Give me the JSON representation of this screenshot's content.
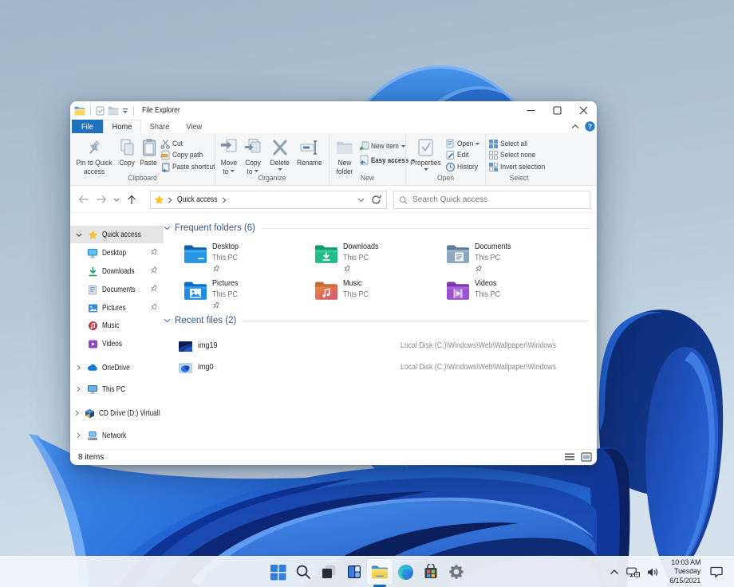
{
  "colors": {
    "accent_blue": "#2071bc",
    "heading_blue": "#33558f",
    "taskbar_bg": "#f2f6fa",
    "wallpaper_light": "#aec3d6",
    "wallpaper_bloom_dark": "#0e2f7e",
    "wallpaper_bloom_bright": "#2e6fdb"
  },
  "window": {
    "title": "File Explorer",
    "qat_icons": [
      "explorer-folder-icon",
      "properties-icon",
      "new-folder-icon",
      "customize-dropdown"
    ],
    "caption": {
      "minimize": "minimize",
      "maximize": "maximize",
      "close": "close"
    },
    "tabs": [
      {
        "label": "File"
      },
      {
        "label": "Home"
      },
      {
        "label": "Share"
      },
      {
        "label": "View"
      }
    ],
    "help_icon": "?"
  },
  "ribbon": {
    "groups": [
      {
        "label": "Clipboard",
        "big": [
          {
            "label": "Pin to Quick access",
            "icon": "pin"
          },
          {
            "label": "Copy",
            "icon": "copy"
          },
          {
            "label": "Paste",
            "icon": "paste"
          }
        ],
        "small": [
          {
            "label": "Cut",
            "icon": "cut"
          },
          {
            "label": "Copy path",
            "icon": "copy-path"
          },
          {
            "label": "Paste shortcut",
            "icon": "paste-shortcut"
          }
        ]
      },
      {
        "label": "Organize",
        "big": [
          {
            "label": "Move to",
            "icon": "move-to",
            "dropdown": true
          },
          {
            "label": "Copy to",
            "icon": "copy-to",
            "dropdown": true
          },
          {
            "label": "Delete",
            "icon": "delete",
            "dropdown": true
          },
          {
            "label": "Rename",
            "icon": "rename"
          }
        ]
      },
      {
        "label": "New",
        "big": [
          {
            "label": "New folder",
            "icon": "new-folder"
          }
        ],
        "small": [
          {
            "label": "New item",
            "icon": "new-item",
            "dropdown": true
          },
          {
            "label": "Easy access",
            "icon": "easy-access",
            "dropdown": true
          }
        ]
      },
      {
        "label": "Open",
        "big": [
          {
            "label": "Properties",
            "icon": "properties",
            "dropdown": true
          }
        ],
        "small": [
          {
            "label": "Open",
            "icon": "open",
            "dropdown": true
          },
          {
            "label": "Edit",
            "icon": "edit"
          },
          {
            "label": "History",
            "icon": "history"
          }
        ]
      },
      {
        "label": "Select",
        "small": [
          {
            "label": "Select all",
            "icon": "select-all"
          },
          {
            "label": "Select none",
            "icon": "select-none"
          },
          {
            "label": "Invert selection",
            "icon": "invert-selection"
          }
        ]
      }
    ]
  },
  "address": {
    "breadcrumb_root": "Quick access",
    "search_placeholder": "Search Quick access"
  },
  "sidebar": {
    "items": [
      {
        "label": "Quick access",
        "icon": "star",
        "expanded": true,
        "selected": true
      },
      {
        "label": "Desktop",
        "icon": "desktop",
        "pinned": true
      },
      {
        "label": "Downloads",
        "icon": "downloads",
        "pinned": true
      },
      {
        "label": "Documents",
        "icon": "documents",
        "pinned": true
      },
      {
        "label": "Pictures",
        "icon": "pictures",
        "pinned": true
      },
      {
        "label": "Music",
        "icon": "music"
      },
      {
        "label": "Videos",
        "icon": "videos"
      },
      {
        "label": "OneDrive",
        "icon": "onedrive",
        "collapsed": true
      },
      {
        "label": "This PC",
        "icon": "this-pc",
        "collapsed": true
      },
      {
        "label": "CD Drive (D:) VirtualI",
        "icon": "cd-drive",
        "collapsed": true
      },
      {
        "label": "Network",
        "icon": "network",
        "collapsed": true
      }
    ]
  },
  "content": {
    "frequent": {
      "title": "Frequent folders (6)",
      "tiles": [
        {
          "name": "Desktop",
          "location": "This PC",
          "pinned": true
        },
        {
          "name": "Downloads",
          "location": "This PC",
          "pinned": true
        },
        {
          "name": "Documents",
          "location": "This PC",
          "pinned": true
        },
        {
          "name": "Pictures",
          "location": "This PC",
          "pinned": true
        },
        {
          "name": "Music",
          "location": "This PC"
        },
        {
          "name": "Videos",
          "location": "This PC"
        }
      ]
    },
    "recent": {
      "title": "Recent files (2)",
      "files": [
        {
          "name": "img19",
          "path": "Local Disk (C:)\\Windows\\Web\\Wallpaper\\Windows"
        },
        {
          "name": "img0",
          "path": "Local Disk (C:)\\Windows\\Web\\Wallpaper\\Windows"
        }
      ]
    }
  },
  "statusbar": {
    "items_count": "8 items"
  },
  "taskbar": {
    "icons": [
      {
        "name": "start"
      },
      {
        "name": "search"
      },
      {
        "name": "task-view"
      },
      {
        "name": "widgets"
      },
      {
        "name": "file-explorer",
        "active": true
      },
      {
        "name": "edge"
      },
      {
        "name": "store"
      },
      {
        "name": "settings"
      }
    ],
    "tray": {
      "time": "10:03 AM",
      "day": "Tuesday",
      "date": "6/15/2021"
    }
  }
}
